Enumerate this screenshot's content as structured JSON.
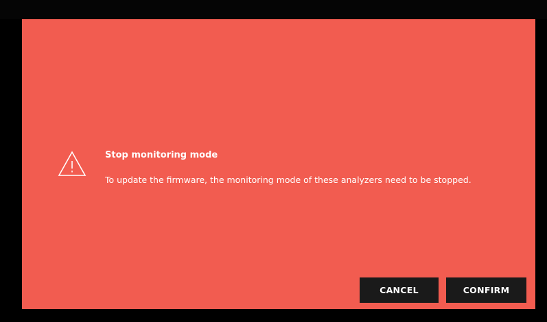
{
  "dialog": {
    "icon": "warning-triangle-icon",
    "title": "Stop monitoring mode",
    "message": "To update the firmware, the monitoring mode of these analyzers need to be stopped.",
    "background_color": "#F25C50"
  },
  "actions": {
    "cancel_label": "CANCEL",
    "confirm_label": "CONFIRM",
    "button_color": "#1A1A1A"
  }
}
